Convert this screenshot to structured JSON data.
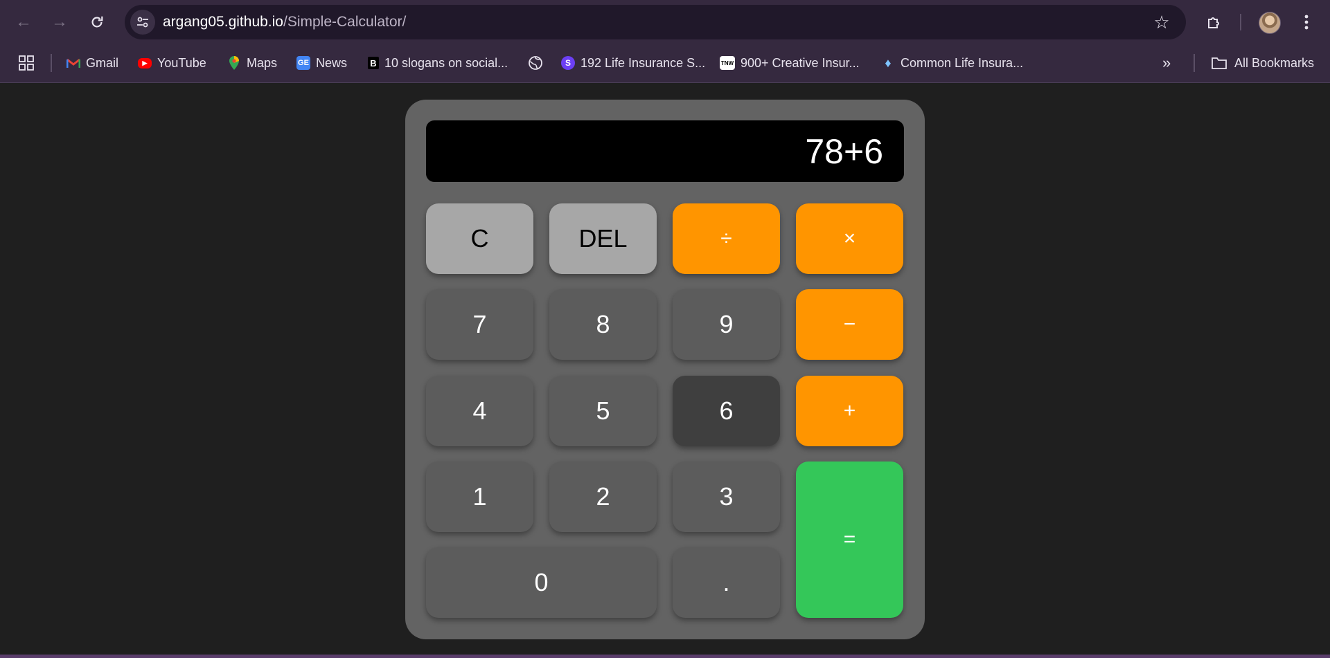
{
  "browser": {
    "url_host": "argang05.github.io",
    "url_path": "/Simple-Calculator/",
    "bookmarks": [
      {
        "label": "Gmail",
        "icon": "gmail-icon"
      },
      {
        "label": "YouTube",
        "icon": "youtube-icon"
      },
      {
        "label": "Maps",
        "icon": "maps-icon"
      },
      {
        "label": "News",
        "icon": "news-icon"
      },
      {
        "label": "10 slogans on social...",
        "icon": "b-icon"
      },
      {
        "label": "",
        "icon": "globe-icon"
      },
      {
        "label": "192 Life Insurance S...",
        "icon": "s-icon"
      },
      {
        "label": "900+ Creative Insur...",
        "icon": "tnw-icon"
      },
      {
        "label": "Common Life Insura...",
        "icon": "gem-icon"
      }
    ],
    "all_bookmarks_label": "All Bookmarks"
  },
  "calculator": {
    "display": "78+6",
    "keys": {
      "clear": "C",
      "delete": "DEL",
      "divide": "÷",
      "multiply": "×",
      "seven": "7",
      "eight": "8",
      "nine": "9",
      "minus": "−",
      "four": "4",
      "five": "5",
      "six": "6",
      "plus": "+",
      "one": "1",
      "two": "2",
      "three": "3",
      "equals": "=",
      "zero": "0",
      "decimal": "."
    },
    "colors": {
      "operator": "#ff9500",
      "equals": "#34c759",
      "function": "#a7a7a7",
      "number": "#5c5c5c",
      "pressed": "#3f3f3f"
    }
  }
}
